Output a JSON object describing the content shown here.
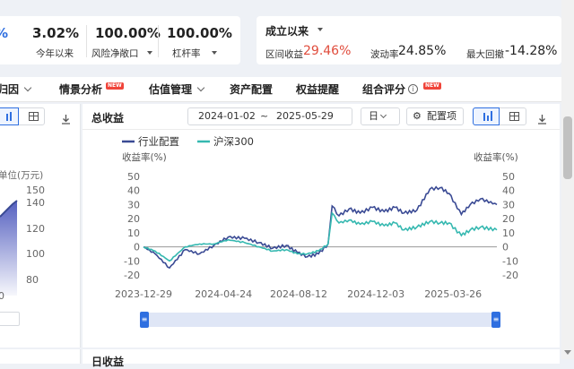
{
  "top_metrics": {
    "partial_value": "%",
    "ytd": {
      "value": "3.02%",
      "label": "今年以来"
    },
    "risk_exposure": {
      "value": "100.00%",
      "label": "风险净敞口"
    },
    "leverage": {
      "value": "100.00%",
      "label": "杠杆率"
    }
  },
  "since_inception": {
    "title": "成立以来",
    "return_label": "区间收益",
    "return_value": "29.46%",
    "vol_label": "波动率",
    "vol_value": "24.85%",
    "mdd_label": "最大回撤",
    "mdd_value": "-14.28%"
  },
  "nav": {
    "items": [
      "归因",
      "情景分析",
      "估值管理",
      "资产配置",
      "权益提醒",
      "组合评分"
    ],
    "new_badge": "NEW"
  },
  "panel": {
    "title": "总收益",
    "start_date": "2024-01-02",
    "range_sep": "~",
    "end_date": "2025-05-29",
    "period": "日",
    "config_label": "配置项"
  },
  "left_chart": {
    "unit_label": "单位(万元)",
    "ticks": [
      "150",
      "140",
      "120",
      "100",
      "80"
    ],
    "x_partial": "0"
  },
  "chart_data": {
    "type": "line",
    "x_ticks": [
      "2023-12-29",
      "2024-04-24",
      "2024-08-12",
      "2024-12-03",
      "2025-03-26"
    ],
    "ylabel": "收益率(%)",
    "ylabel_right": "收益率(%)",
    "ylim": [
      -20,
      50
    ],
    "y_ticks": [
      50,
      40,
      30,
      20,
      10,
      0,
      -10,
      -20
    ],
    "grid": true,
    "legend": "top-left",
    "series": [
      {
        "name": "行业配置",
        "color": "#3a4a94",
        "x": [
          "2023-12-29",
          "2024-01-15",
          "2024-02-05",
          "2024-02-28",
          "2024-03-20",
          "2024-04-10",
          "2024-05-01",
          "2024-05-25",
          "2024-06-15",
          "2024-07-05",
          "2024-07-25",
          "2024-08-10",
          "2024-08-25",
          "2024-09-10",
          "2024-09-24",
          "2024-09-30",
          "2024-10-10",
          "2024-10-25",
          "2024-11-10",
          "2024-11-28",
          "2024-12-15",
          "2024-12-31",
          "2025-01-13",
          "2025-02-01",
          "2025-02-20",
          "2025-03-07",
          "2025-03-20",
          "2025-04-07",
          "2025-04-20",
          "2025-05-05",
          "2025-05-29"
        ],
        "y": [
          0,
          -5,
          -15,
          -2,
          -5,
          1,
          7,
          6,
          3,
          -1,
          1,
          -4,
          -7,
          -5,
          2,
          29,
          22,
          27,
          24,
          28,
          25,
          28,
          24,
          26,
          41,
          42,
          38,
          23,
          30,
          34,
          30
        ]
      },
      {
        "name": "沪深300",
        "color": "#35b8b0",
        "x": [
          "2023-12-29",
          "2024-01-15",
          "2024-02-05",
          "2024-02-28",
          "2024-03-20",
          "2024-04-10",
          "2024-05-01",
          "2024-05-25",
          "2024-06-15",
          "2024-07-05",
          "2024-07-25",
          "2024-08-10",
          "2024-08-25",
          "2024-09-10",
          "2024-09-24",
          "2024-09-30",
          "2024-10-10",
          "2024-10-25",
          "2024-11-10",
          "2024-11-28",
          "2024-12-15",
          "2024-12-31",
          "2025-01-13",
          "2025-02-01",
          "2025-02-20",
          "2025-03-07",
          "2025-03-20",
          "2025-04-07",
          "2025-04-20",
          "2025-05-05",
          "2025-05-29"
        ],
        "y": [
          0,
          -3,
          -10,
          0,
          2,
          2,
          5,
          3,
          0,
          -3,
          -2,
          -5,
          -5,
          -3,
          2,
          24,
          17,
          19,
          16,
          18,
          15,
          17,
          12,
          14,
          18,
          17,
          17,
          8,
          12,
          14,
          12
        ]
      }
    ]
  },
  "colors": {
    "accent": "#2f6fe0",
    "red": "#e04c3c",
    "series1": "#3a4a94",
    "series2": "#35b8b0"
  },
  "bottom_partial_title": "日收益"
}
